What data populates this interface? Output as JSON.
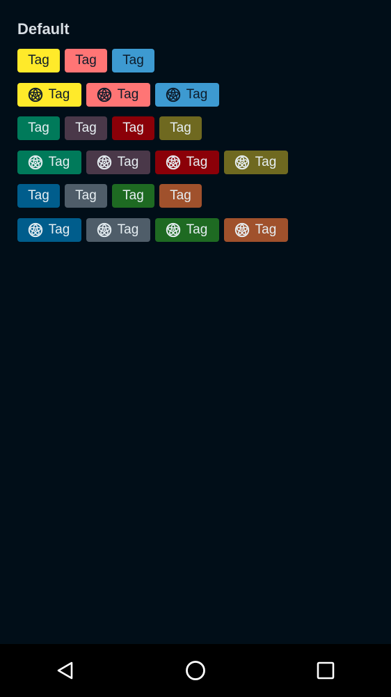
{
  "section": {
    "title": "Default"
  },
  "rows": [
    {
      "icon": false,
      "tags": [
        {
          "label": "Tag",
          "bg": "#ffea2a",
          "fg": "#0d1b2a"
        },
        {
          "label": "Tag",
          "bg": "#ff7575",
          "fg": "#0d1b2a"
        },
        {
          "label": "Tag",
          "bg": "#3d9ad1",
          "fg": "#0d1b2a"
        }
      ]
    },
    {
      "icon": true,
      "tags": [
        {
          "label": "Tag",
          "bg": "#ffea2a",
          "fg": "#0d1b2a"
        },
        {
          "label": "Tag",
          "bg": "#ff7575",
          "fg": "#0d1b2a"
        },
        {
          "label": "Tag",
          "bg": "#3d9ad1",
          "fg": "#0d1b2a"
        }
      ]
    },
    {
      "icon": false,
      "tags": [
        {
          "label": "Tag",
          "bg": "#007a5a",
          "fg": "#e6eef2"
        },
        {
          "label": "Tag",
          "bg": "#4a3849",
          "fg": "#e6eef2"
        },
        {
          "label": "Tag",
          "bg": "#8b0008",
          "fg": "#e6eef2"
        },
        {
          "label": "Tag",
          "bg": "#6f6920",
          "fg": "#e6eef2"
        }
      ]
    },
    {
      "icon": true,
      "tags": [
        {
          "label": "Tag",
          "bg": "#007a5a",
          "fg": "#e6eef2"
        },
        {
          "label": "Tag",
          "bg": "#4a3849",
          "fg": "#e6eef2"
        },
        {
          "label": "Tag",
          "bg": "#8b0008",
          "fg": "#e6eef2"
        },
        {
          "label": "Tag",
          "bg": "#6f6920",
          "fg": "#e6eef2"
        }
      ]
    },
    {
      "icon": false,
      "tags": [
        {
          "label": "Tag",
          "bg": "#005d8c",
          "fg": "#e6eef2"
        },
        {
          "label": "Tag",
          "bg": "#4f5d69",
          "fg": "#e6eef2"
        },
        {
          "label": "Tag",
          "bg": "#1e6a22",
          "fg": "#e6eef2"
        },
        {
          "label": "Tag",
          "bg": "#a0512c",
          "fg": "#e6eef2"
        }
      ]
    },
    {
      "icon": true,
      "tags": [
        {
          "label": "Tag",
          "bg": "#005d8c",
          "fg": "#e6eef2"
        },
        {
          "label": "Tag",
          "bg": "#4f5d69",
          "fg": "#e6eef2"
        },
        {
          "label": "Tag",
          "bg": "#1e6a22",
          "fg": "#e6eef2"
        },
        {
          "label": "Tag",
          "bg": "#a0512c",
          "fg": "#e6eef2"
        }
      ]
    }
  ],
  "tag_icon": "film-reel-icon",
  "navigation": {
    "back_icon": "back-triangle-icon",
    "home_icon": "home-circle-icon",
    "recents_icon": "recents-square-icon",
    "icon_color": "#ffffff"
  },
  "colors": {
    "background": "#010e18",
    "nav_background": "#000000",
    "title_text": "#d7dde3"
  }
}
